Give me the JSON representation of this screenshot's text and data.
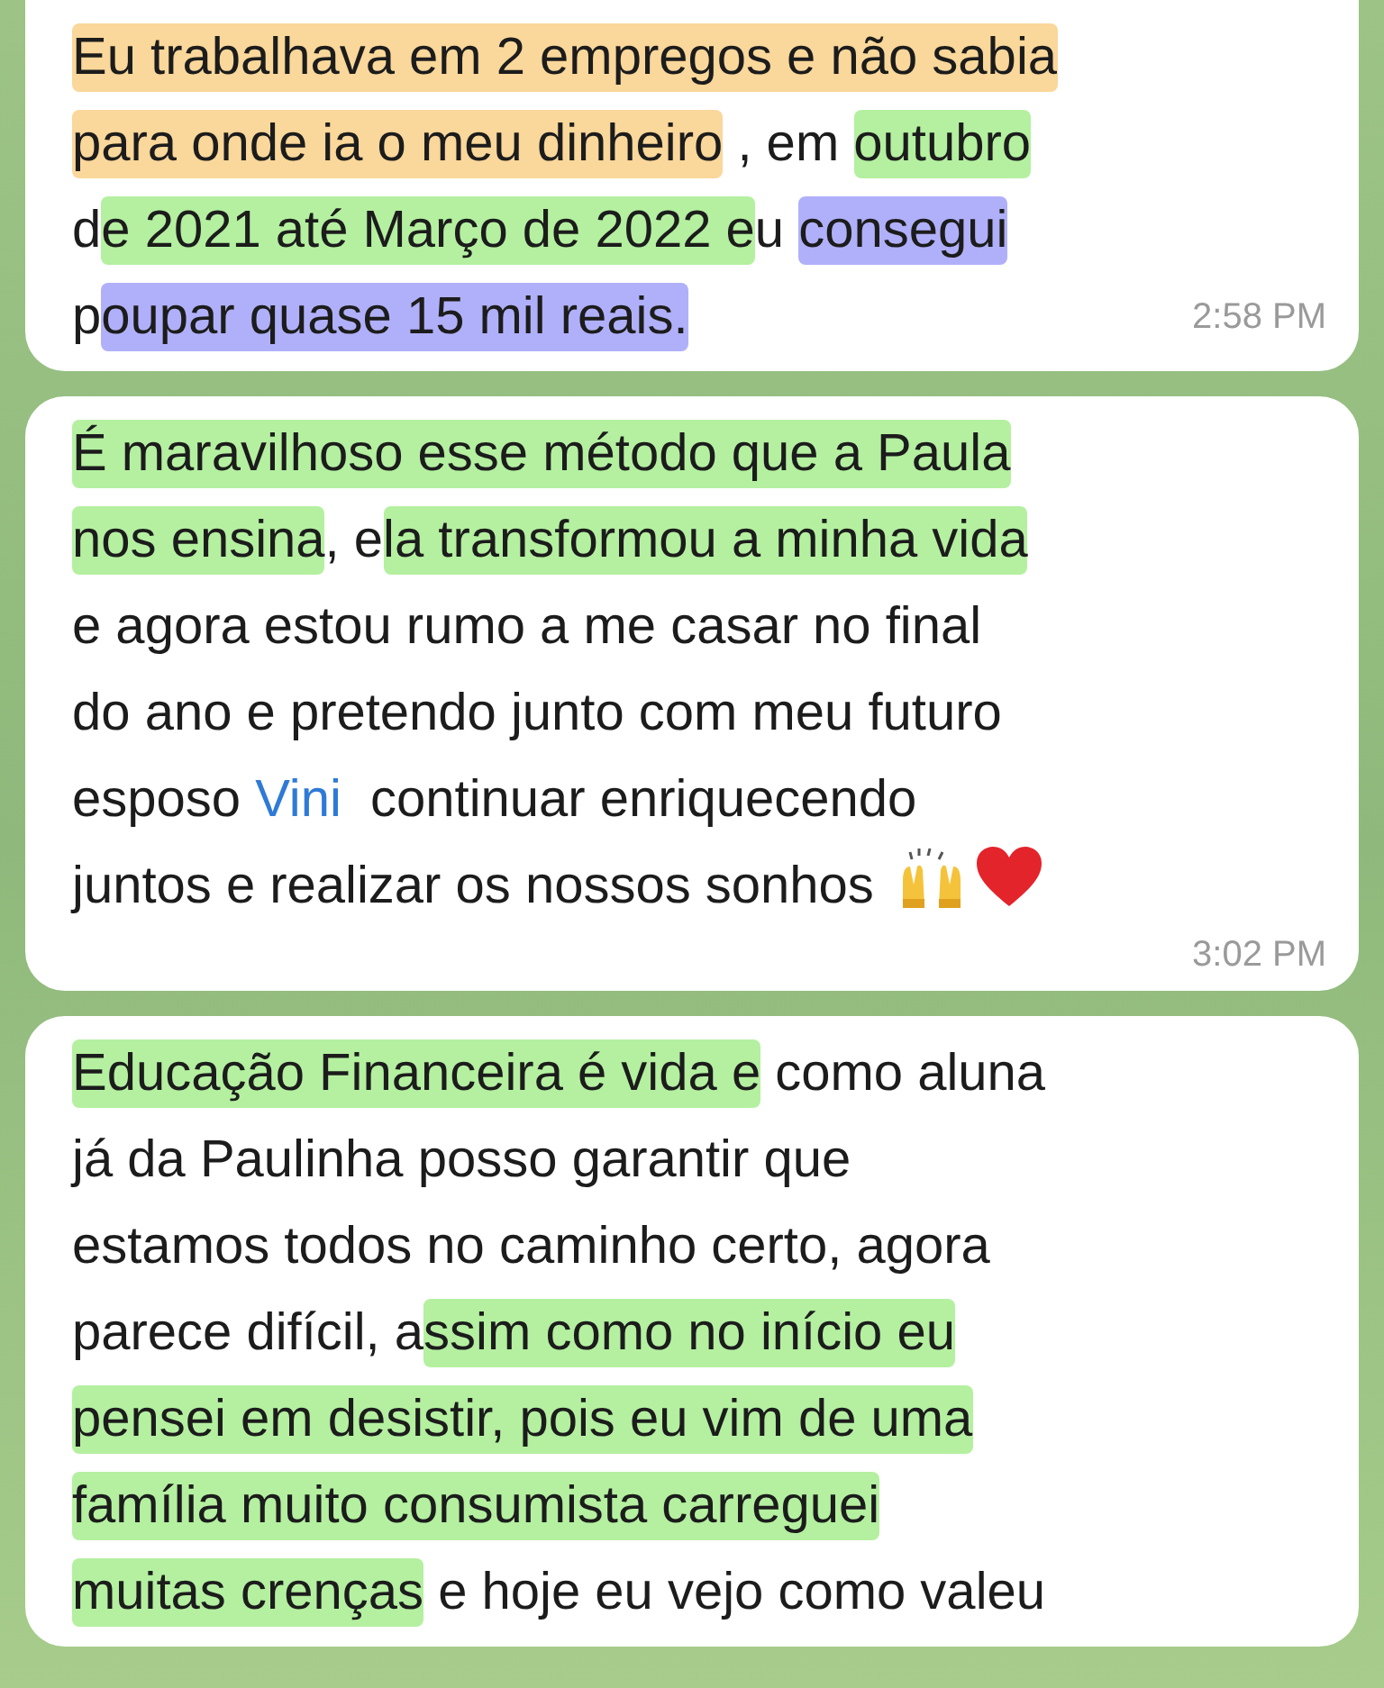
{
  "messages": [
    {
      "time": "2:58 PM",
      "time_inline": true,
      "lines": [
        [
          {
            "kind": "highlight",
            "color": "#fad79a",
            "text": "Eu trabalhava em 2 empregos e não sabia"
          }
        ],
        [
          {
            "kind": "highlight",
            "color": "#fad79a",
            "text": "para onde ia o meu dinheiro"
          },
          {
            "kind": "plain",
            "text": " , em "
          },
          {
            "kind": "highlight",
            "color": "#b4f0a0",
            "text": "outubro"
          }
        ],
        [
          {
            "kind": "plain",
            "text": "d"
          },
          {
            "kind": "highlight",
            "color": "#b4f0a0",
            "text": "e 2021 até Março de 2022 e"
          },
          {
            "kind": "plain",
            "text": "u "
          },
          {
            "kind": "highlight",
            "color": "#b0b0fa",
            "text": "consegui"
          }
        ],
        [
          {
            "kind": "plain",
            "text": "p"
          },
          {
            "kind": "highlight",
            "color": "#b0b0fa",
            "text": "oupar quase 15 mil reais."
          }
        ]
      ]
    },
    {
      "time": "3:02 PM",
      "time_inline": false,
      "lines": [
        [
          {
            "kind": "highlight",
            "color": "#b4f0a0",
            "text": "É maravilhoso esse método que a Paula"
          }
        ],
        [
          {
            "kind": "highlight",
            "color": "#b4f0a0",
            "text": "nos ensina"
          },
          {
            "kind": "plain",
            "text": ", e"
          },
          {
            "kind": "highlight",
            "color": "#b4f0a0",
            "text": "la transformou a minha vida"
          }
        ],
        [
          {
            "kind": "plain",
            "text": "e agora estou rumo a me casar no final"
          }
        ],
        [
          {
            "kind": "plain",
            "text": "do ano e pretendo junto com meu futuro"
          }
        ],
        [
          {
            "kind": "plain",
            "text": "esposo "
          },
          {
            "kind": "link",
            "text": "Vini"
          },
          {
            "kind": "plain",
            "text": "  continuar enriquecendo"
          }
        ],
        [
          {
            "kind": "plain",
            "text": "juntos e realizar os nossos sonhos "
          },
          {
            "kind": "hands-emoji"
          },
          {
            "kind": "heart-emoji"
          }
        ]
      ]
    },
    {
      "lines": [
        [
          {
            "kind": "highlight",
            "color": "#b4f0a0",
            "text": "Educação Financeira é vida e"
          },
          {
            "kind": "plain",
            "text": " como aluna"
          }
        ],
        [
          {
            "kind": "plain",
            "text": "já da Paulinha posso garantir que"
          }
        ],
        [
          {
            "kind": "plain",
            "text": "estamos todos no caminho certo, agora"
          }
        ],
        [
          {
            "kind": "plain",
            "text": "parece difícil, a"
          },
          {
            "kind": "highlight",
            "color": "#b4f0a0",
            "text": "ssim como no início eu"
          }
        ],
        [
          {
            "kind": "highlight",
            "color": "#b4f0a0",
            "text": "pensei em desistir, pois eu vim de uma"
          }
        ],
        [
          {
            "kind": "highlight",
            "color": "#b4f0a0",
            "text": "família muito consumista carreguei"
          }
        ],
        [
          {
            "kind": "highlight",
            "color": "#b4f0a0",
            "text": "muitas crenças"
          },
          {
            "kind": "plain",
            "text": " e hoje eu vejo como valeu"
          }
        ]
      ]
    }
  ]
}
